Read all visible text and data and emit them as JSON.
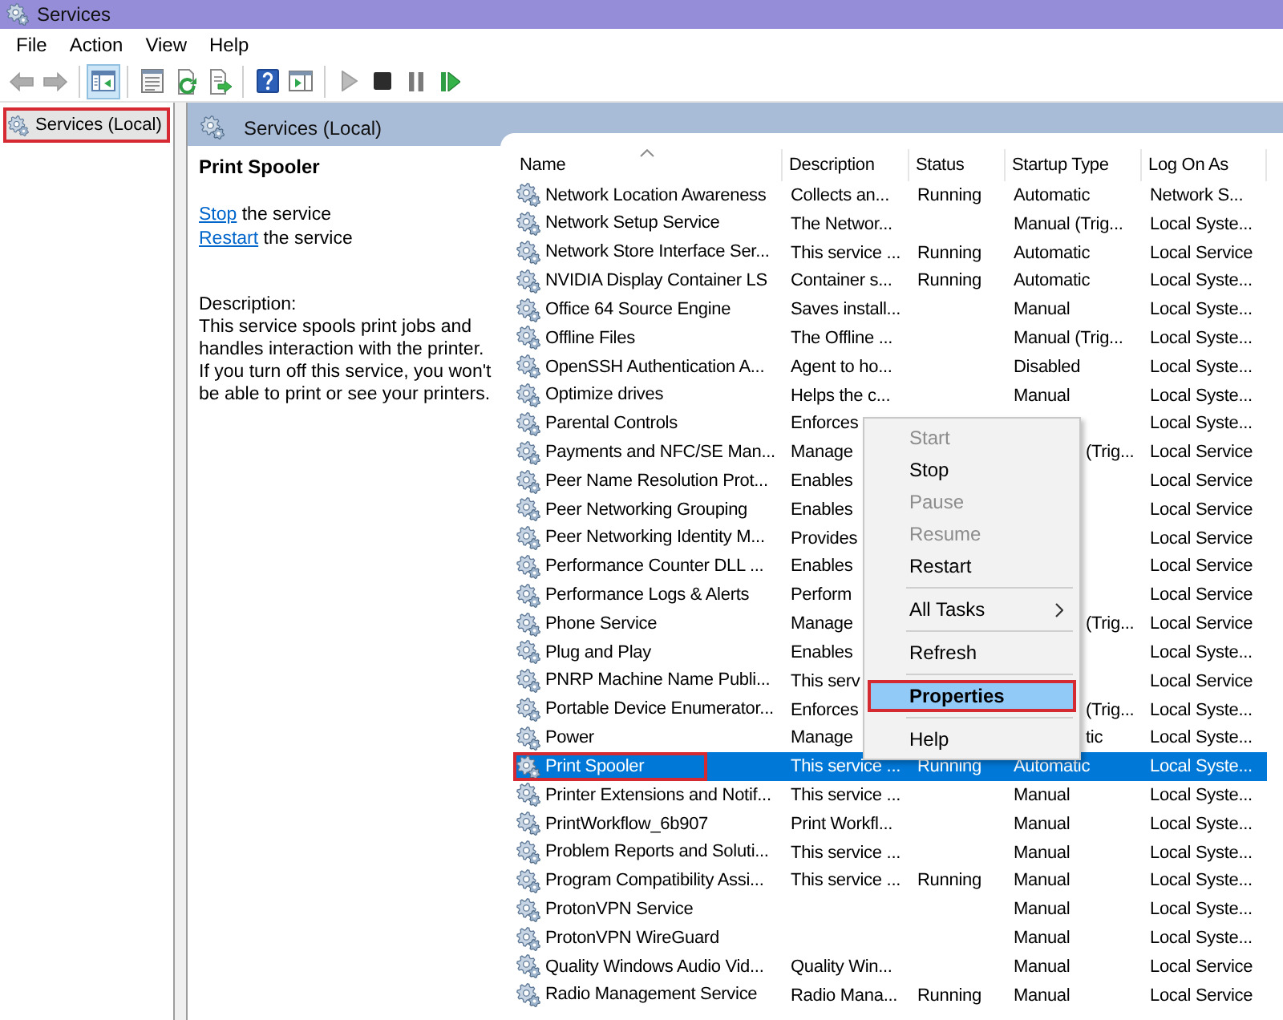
{
  "window": {
    "title": "Services"
  },
  "menu": [
    "File",
    "Action",
    "View",
    "Help"
  ],
  "toolbar": [
    {
      "kind": "back",
      "disabled": true,
      "pressed": false
    },
    {
      "kind": "forward",
      "disabled": true,
      "pressed": false
    },
    {
      "kind": "separator"
    },
    {
      "kind": "tree",
      "disabled": false,
      "pressed": true
    },
    {
      "kind": "separator"
    },
    {
      "kind": "properties",
      "disabled": false,
      "pressed": false
    },
    {
      "kind": "refresh",
      "disabled": false,
      "pressed": false
    },
    {
      "kind": "export",
      "disabled": false,
      "pressed": false
    },
    {
      "kind": "separator"
    },
    {
      "kind": "help",
      "disabled": false,
      "pressed": false
    },
    {
      "kind": "pane",
      "disabled": false,
      "pressed": false
    },
    {
      "kind": "separator"
    },
    {
      "kind": "start",
      "disabled": true,
      "pressed": false
    },
    {
      "kind": "stop",
      "disabled": false,
      "pressed": false
    },
    {
      "kind": "pause",
      "disabled": true,
      "pressed": false
    },
    {
      "kind": "restart",
      "disabled": false,
      "pressed": false
    }
  ],
  "tree": [
    {
      "label": "Services (Local)",
      "selected": true,
      "highlighted": true
    }
  ],
  "panel": {
    "title": "Services (Local)"
  },
  "details": {
    "title": "Print Spooler",
    "actions": [
      {
        "link": "Stop",
        "text": "the service"
      },
      {
        "link": "Restart",
        "text": "the service"
      }
    ],
    "description_label": "Description:",
    "description": "This service spools print jobs and handles interaction with the printer. If you turn off this service, you won't be able to print or see your printers."
  },
  "table": {
    "columns": [
      {
        "label": "Name",
        "sorted": true
      },
      {
        "label": "Description",
        "sorted": false
      },
      {
        "label": "Status",
        "sorted": false
      },
      {
        "label": "Startup Type",
        "sorted": false
      },
      {
        "label": "Log On As",
        "sorted": false
      }
    ],
    "rows": [
      {
        "name": "Network Location Awareness",
        "description": "Collects an...",
        "status": "Running",
        "startup_type": "Automatic",
        "log_on_as": "Network S...",
        "selected": false,
        "highlighted": false
      },
      {
        "name": "Network Setup Service",
        "description": "The Networ...",
        "startup_type": "Manual (Trig...",
        "log_on_as": "Local Syste...",
        "selected": false,
        "highlighted": false
      },
      {
        "name": "Network Store Interface Ser...",
        "description": "This service ...",
        "status": "Running",
        "startup_type": "Automatic",
        "log_on_as": "Local Service",
        "selected": false,
        "highlighted": false
      },
      {
        "name": "NVIDIA Display Container LS",
        "description": "Container s...",
        "status": "Running",
        "startup_type": "Automatic",
        "log_on_as": "Local Syste...",
        "selected": false,
        "highlighted": false
      },
      {
        "name": "Office 64 Source Engine",
        "description": "Saves install...",
        "startup_type": "Manual",
        "log_on_as": "Local Syste...",
        "selected": false,
        "highlighted": false
      },
      {
        "name": "Offline Files",
        "description": "The Offline ...",
        "startup_type": "Manual (Trig...",
        "log_on_as": "Local Syste...",
        "selected": false,
        "highlighted": false
      },
      {
        "name": "OpenSSH Authentication A...",
        "description": "Agent to ho...",
        "startup_type": "Disabled",
        "log_on_as": "Local Syste...",
        "selected": false,
        "highlighted": false
      },
      {
        "name": "Optimize drives",
        "description": "Helps the c...",
        "startup_type": "Manual",
        "log_on_as": "Local Syste...",
        "selected": false,
        "highlighted": false
      },
      {
        "name": "Parental Controls",
        "description": "Enforces",
        "log_on_as": "Local Syste...",
        "selected": false,
        "highlighted": false
      },
      {
        "name": "Payments and NFC/SE Man...",
        "description": "Manage",
        "startup_type": "(Trig...",
        "log_on_as": "Local Service",
        "selected": false,
        "highlighted": false
      },
      {
        "name": "Peer Name Resolution Prot...",
        "description": "Enables",
        "log_on_as": "Local Service",
        "selected": false,
        "highlighted": false
      },
      {
        "name": "Peer Networking Grouping",
        "description": "Enables",
        "log_on_as": "Local Service",
        "selected": false,
        "highlighted": false
      },
      {
        "name": "Peer Networking Identity M...",
        "description": "Provides",
        "log_on_as": "Local Service",
        "selected": false,
        "highlighted": false
      },
      {
        "name": "Performance Counter DLL ...",
        "description": "Enables",
        "log_on_as": "Local Service",
        "selected": false,
        "highlighted": false
      },
      {
        "name": "Performance Logs & Alerts",
        "description": "Perform",
        "log_on_as": "Local Service",
        "selected": false,
        "highlighted": false
      },
      {
        "name": "Phone Service",
        "description": "Manage",
        "startup_type": "(Trig...",
        "log_on_as": "Local Service",
        "selected": false,
        "highlighted": false
      },
      {
        "name": "Plug and Play",
        "description": "Enables",
        "log_on_as": "Local Syste...",
        "selected": false,
        "highlighted": false
      },
      {
        "name": "PNRP Machine Name Publi...",
        "description": "This serv",
        "log_on_as": "Local Service",
        "selected": false,
        "highlighted": false
      },
      {
        "name": "Portable Device Enumerator...",
        "description": "Enforces",
        "startup_type": "(Trig...",
        "log_on_as": "Local Syste...",
        "selected": false,
        "highlighted": false
      },
      {
        "name": "Power",
        "description": "Manage",
        "startup_type": "tic",
        "log_on_as": "Local Syste...",
        "selected": false,
        "highlighted": false
      },
      {
        "name": "Print Spooler",
        "description": "This service ...",
        "status": "Running",
        "startup_type": "Automatic",
        "log_on_as": "Local Syste...",
        "selected": true,
        "highlighted": true
      },
      {
        "name": "Printer Extensions and Notif...",
        "description": "This service ...",
        "startup_type": "Manual",
        "log_on_as": "Local Syste...",
        "selected": false,
        "highlighted": false
      },
      {
        "name": "PrintWorkflow_6b907",
        "description": "Print Workfl...",
        "startup_type": "Manual",
        "log_on_as": "Local Syste...",
        "selected": false,
        "highlighted": false
      },
      {
        "name": "Problem Reports and Soluti...",
        "description": "This service ...",
        "startup_type": "Manual",
        "log_on_as": "Local Syste...",
        "selected": false,
        "highlighted": false
      },
      {
        "name": "Program Compatibility Assi...",
        "description": "This service ...",
        "status": "Running",
        "startup_type": "Manual",
        "log_on_as": "Local Syste...",
        "selected": false,
        "highlighted": false
      },
      {
        "name": "ProtonVPN Service",
        "startup_type": "Manual",
        "log_on_as": "Local Syste...",
        "selected": false,
        "highlighted": false
      },
      {
        "name": "ProtonVPN WireGuard",
        "startup_type": "Manual",
        "log_on_as": "Local Syste...",
        "selected": false,
        "highlighted": false
      },
      {
        "name": "Quality Windows Audio Vid...",
        "description": "Quality Win...",
        "startup_type": "Manual",
        "log_on_as": "Local Service",
        "selected": false,
        "highlighted": false
      },
      {
        "name": "Radio Management Service",
        "description": "Radio Mana...",
        "status": "Running",
        "startup_type": "Manual",
        "log_on_as": "Local Service",
        "selected": false,
        "highlighted": false
      }
    ]
  },
  "context_menu": {
    "items": [
      {
        "kind": "item",
        "label": "Start",
        "disabled": true,
        "selected": false,
        "default": false,
        "highlighted": false
      },
      {
        "kind": "item",
        "label": "Stop",
        "disabled": false,
        "selected": false,
        "default": false,
        "highlighted": false
      },
      {
        "kind": "item",
        "label": "Pause",
        "disabled": true,
        "selected": false,
        "default": false,
        "highlighted": false
      },
      {
        "kind": "item",
        "label": "Resume",
        "disabled": true,
        "selected": false,
        "default": false,
        "highlighted": false
      },
      {
        "kind": "item",
        "label": "Restart",
        "disabled": false,
        "selected": false,
        "default": false,
        "highlighted": false
      },
      {
        "kind": "separator"
      },
      {
        "kind": "submenu",
        "label": "All Tasks",
        "disabled": false,
        "selected": false,
        "default": false,
        "highlighted": false
      },
      {
        "kind": "separator"
      },
      {
        "kind": "item",
        "label": "Refresh",
        "disabled": false,
        "selected": false,
        "default": false,
        "highlighted": false
      },
      {
        "kind": "separator"
      },
      {
        "kind": "item",
        "label": "Properties",
        "disabled": false,
        "selected": true,
        "default": true,
        "highlighted": true
      },
      {
        "kind": "separator"
      },
      {
        "kind": "item",
        "label": "Help",
        "disabled": false,
        "selected": false,
        "default": false,
        "highlighted": false
      }
    ]
  }
}
